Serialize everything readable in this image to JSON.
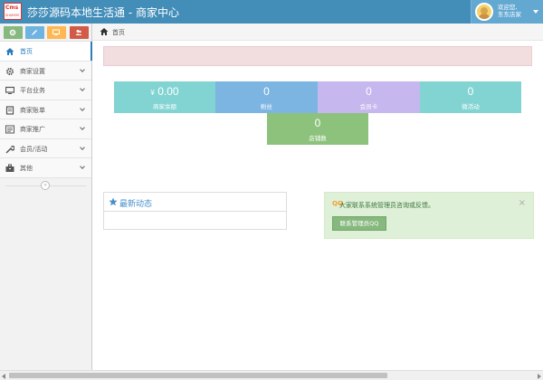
{
  "header": {
    "logo_text": "Cms",
    "logo_sub": "SHAREM",
    "title": "莎莎源码本地生活通 - 商家中心",
    "user": {
      "welcome": "欢迎您,",
      "name": "东东店家"
    }
  },
  "shortcuts": [
    {
      "icon": "gear-icon",
      "color": "#87b87f"
    },
    {
      "icon": "pencil-icon",
      "color": "#6fb3e0"
    },
    {
      "icon": "desktop-icon",
      "color": "#ffb752"
    },
    {
      "icon": "users-icon",
      "color": "#d15b47"
    }
  ],
  "sidebar": {
    "items": [
      {
        "label": "首页",
        "icon": "home-icon"
      },
      {
        "label": "商家设置",
        "icon": "gear-icon"
      },
      {
        "label": "平台业务",
        "icon": "desktop-icon"
      },
      {
        "label": "商家账单",
        "icon": "book-icon"
      },
      {
        "label": "商家推广",
        "icon": "list-icon"
      },
      {
        "label": "会员/活动",
        "icon": "wrench-icon"
      },
      {
        "label": "其他",
        "icon": "briefcase-icon"
      }
    ],
    "collapse_glyph": "«"
  },
  "breadcrumb": {
    "label": "首页"
  },
  "stats": [
    {
      "value": "0.00",
      "prefix": "¥",
      "label": "商家余额",
      "color": "#82d4d2"
    },
    {
      "value": "0",
      "label": "粉丝",
      "color": "#7cb4e2"
    },
    {
      "value": "0",
      "label": "会员卡",
      "color": "#c6b7ef"
    },
    {
      "value": "0",
      "label": "微活动",
      "color": "#82d4d2"
    },
    {
      "value": "0",
      "label": "店铺数",
      "color": "#8dc27c"
    }
  ],
  "news": {
    "title": "最新动态"
  },
  "info": {
    "prefix": "QQ",
    "text": "大家联系系统管理员咨询或反馈。",
    "close": "×",
    "button": "联系管理员QQ"
  }
}
